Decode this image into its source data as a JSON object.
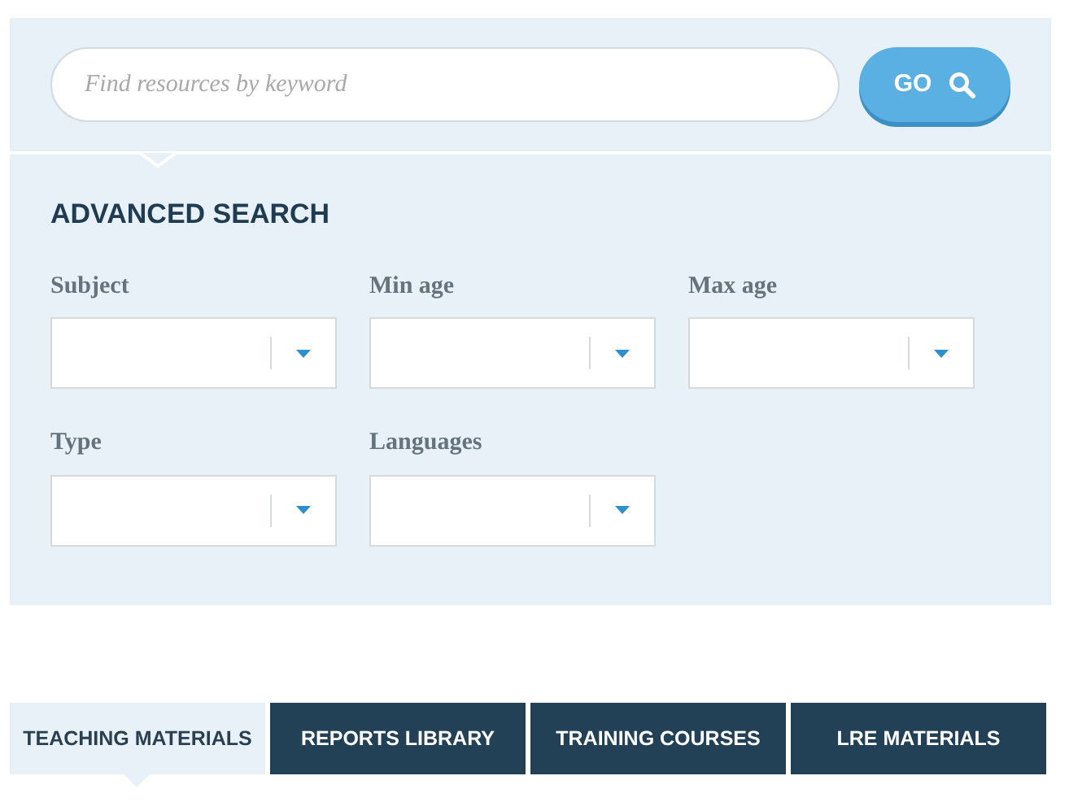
{
  "search": {
    "placeholder": "Find resources by keyword",
    "button": "GO"
  },
  "advanced_search": {
    "title": "ADVANCED SEARCH",
    "fields": [
      {
        "label": "Subject"
      },
      {
        "label": "Min age"
      },
      {
        "label": "Max age"
      },
      {
        "label": "Type"
      },
      {
        "label": "Languages"
      }
    ]
  },
  "tabs": [
    {
      "label": "TEACHING MATERIALS",
      "selected": true
    },
    {
      "label": "REPORTS LIBRARY",
      "selected": false
    },
    {
      "label": "TRAINING COURSES",
      "selected": false
    },
    {
      "label": "LRE MATERIALS",
      "selected": false
    }
  ]
}
